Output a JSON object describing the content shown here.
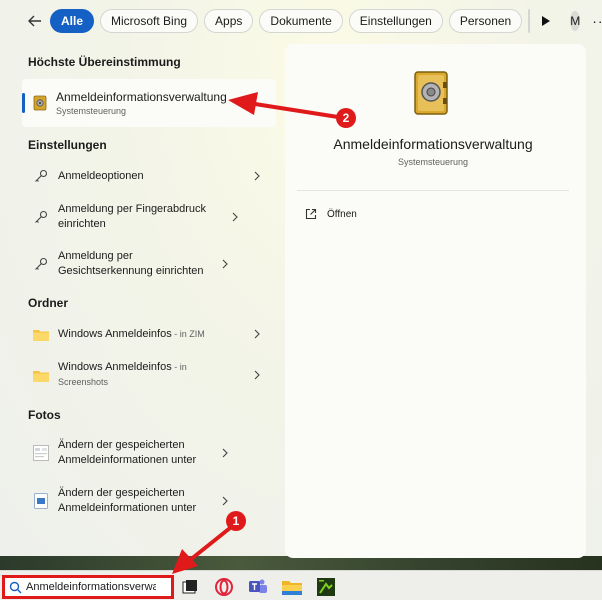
{
  "filter_bar": {
    "chips": [
      "Alle",
      "Microsoft Bing",
      "Apps",
      "Dokumente",
      "Einstellungen",
      "Personen"
    ],
    "avatar_initial": "M"
  },
  "best_match": {
    "heading": "Höchste Übereinstimmung",
    "title": "Anmeldeinformationsverwaltung",
    "subtitle": "Systemsteuerung"
  },
  "settings": {
    "heading": "Einstellungen",
    "items": [
      {
        "label": "Anmeldeoptionen"
      },
      {
        "label": "Anmeldung per Fingerabdruck einrichten"
      },
      {
        "label": "Anmeldung per Gesichtserkennung einrichten"
      }
    ]
  },
  "folders": {
    "heading": "Ordner",
    "items": [
      {
        "label": "Windows Anmeldeinfos",
        "loc": " - in ZIM"
      },
      {
        "label": "Windows Anmeldeinfos",
        "loc": " - in",
        "loc2": "Screenshots"
      }
    ]
  },
  "photos": {
    "heading": "Fotos",
    "items": [
      {
        "label": "Ändern der gespeicherten Anmeldeinformationen unter"
      },
      {
        "label": "Ändern der gespeicherten Anmeldeinformationen unter"
      }
    ]
  },
  "preview": {
    "title": "Anmeldeinformationsverwaltung",
    "subtitle": "Systemsteuerung",
    "open_label": "Öffnen"
  },
  "taskbar": {
    "search_value": "Anmeldeinformationsverwaltung"
  },
  "markers": [
    "1",
    "2"
  ],
  "colors": {
    "accent": "#1560c4",
    "annotation": "#e01a1a"
  }
}
